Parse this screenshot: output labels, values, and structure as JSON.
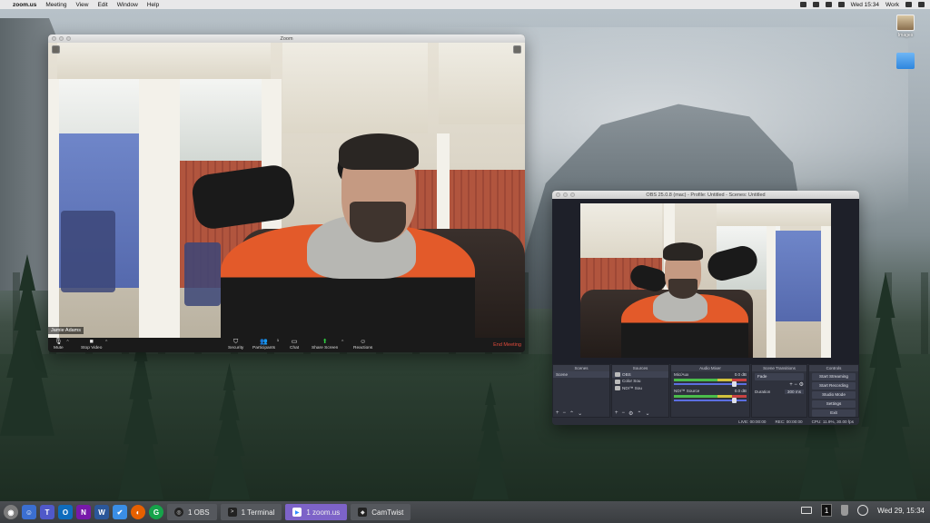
{
  "menubar": {
    "app": "zoom.us",
    "items": [
      "Meeting",
      "View",
      "Edit",
      "Window",
      "Help"
    ],
    "clock": "Wed 15:34",
    "user": "Work"
  },
  "desktop": {
    "icons": [
      {
        "label": "Images",
        "icon": "image-folder-icon"
      },
      {
        "label": "",
        "icon": "folder-icon"
      }
    ]
  },
  "zoom": {
    "title": "Zoom",
    "participant_name": "Jamie Adams",
    "toolbar": {
      "mute": "Mute",
      "stop_video": "Stop Video",
      "security": "Security",
      "participants": "Participants",
      "participants_count": "1",
      "chat": "Chat",
      "share_screen": "Share Screen",
      "reactions": "Reactions",
      "end_meeting": "End Meeting"
    },
    "colors": {
      "end": "#e24b3b",
      "share": "#2ecc40"
    }
  },
  "obs": {
    "title": "OBS 25.0.8 (mac) - Profile: Untitled - Scenes: Untitled",
    "docks": {
      "scenes": {
        "header": "Scenes",
        "items": [
          "Scene"
        ]
      },
      "sources": {
        "header": "Sources",
        "items": [
          "OBS",
          "Color Sou",
          "NDI™ Sou"
        ]
      },
      "audio": {
        "header": "Audio Mixer",
        "channels": [
          {
            "name": "Mic/Aux",
            "db": "0.0 dB",
            "level": 0.8
          },
          {
            "name": "NDI™ Source",
            "db": "0.0 dB",
            "level": 0.8
          }
        ]
      },
      "transitions": {
        "header": "Scene Transitions",
        "type": "Fade",
        "duration_label": "Duration",
        "duration": "300 ms"
      },
      "controls": {
        "header": "Controls",
        "buttons": [
          "Start Streaming",
          "Start Recording",
          "Studio Mode",
          "Settings",
          "Exit"
        ]
      }
    },
    "status": {
      "live": "LIVE: 00:00:00",
      "rec": "REC: 00:00:00",
      "cpu": "CPU: 11.9%, 30.00 fps"
    }
  },
  "taskbar": {
    "tasks": [
      {
        "label": "1 OBS",
        "active": false
      },
      {
        "label": "1 Terminal",
        "active": false
      },
      {
        "label": "1 zoom.us",
        "active": true
      },
      {
        "label": "CamTwist",
        "active": false
      }
    ],
    "tray_number": "1",
    "datetime": "Wed 29, 15:34"
  }
}
